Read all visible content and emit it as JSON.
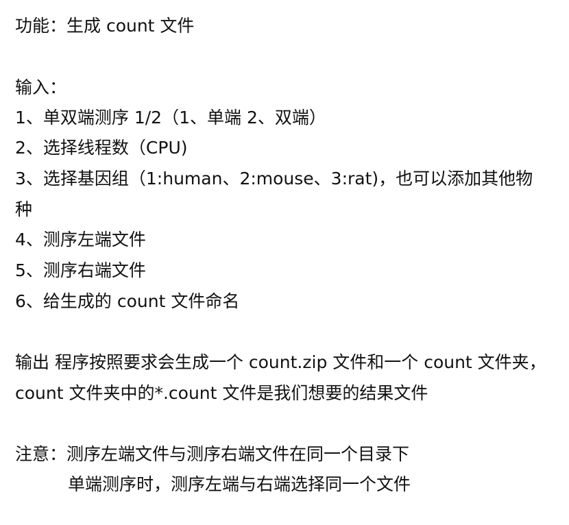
{
  "function_line": "功能：生成 count 文件",
  "input": {
    "heading": "输入：",
    "items": [
      "1、单双端测序 1/2（1、单端  2、双端）",
      "2、选择线程数（CPU)",
      "3、选择基因组（1:human、2:mouse、3:rat)，也可以添加其他物",
      "种",
      "4、测序左端文件",
      "5、测序右端文件",
      "6、给生成的 count 文件命名"
    ]
  },
  "output": {
    "line1": "输出  程序按照要求会生成一个 count.zip 文件和一个 count 文件夹，",
    "line2": "count 文件夹中的*.count 文件是我们想要的结果文件"
  },
  "notes": {
    "line1": "注意：测序左端文件与测序右端文件在同一个目录下",
    "line2": "单端测序时，测序左端与右端选择同一个文件"
  }
}
